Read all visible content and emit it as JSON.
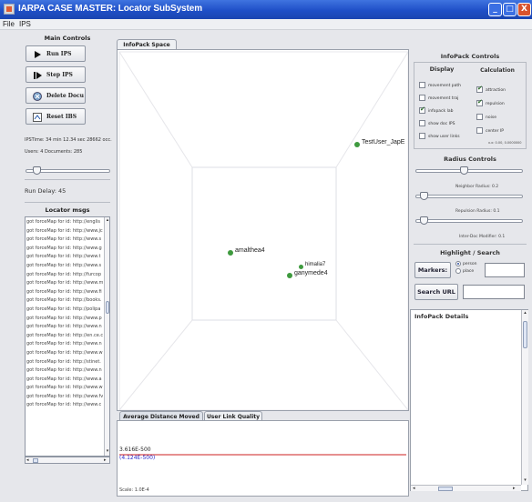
{
  "window": {
    "title": "IARPA CASE MASTER: Locator SubSystem",
    "min": "_",
    "max": "□",
    "close": "X"
  },
  "menu": {
    "file": "File",
    "ips": "IPS"
  },
  "main_controls": {
    "title": "Main Controls",
    "run": "Run IPS",
    "step": "Step IPS",
    "delete": "Delete Docu",
    "reset": "Reset IBS",
    "ips_time": "IPSTime: 34 min 12.34 sec  28662 occ.",
    "users_docs": "Users: 4  Documents: 285",
    "run_delay": "Run Delay: 45",
    "run_delay_value": 0.1
  },
  "locator_msgs": {
    "title": "Locator msgs",
    "rows": [
      "got forceMap for id: http://englis",
      "got forceMap for id: http://www.jc",
      "got forceMap for id: http://www.s",
      "got forceMap for id: http://www.g",
      "got forceMap for id: http://www.t",
      "got forceMap for id: http://www.s",
      "got forceMap for id: http://furcop",
      "got forceMap for id: http://www.m",
      "got forceMap for id: http://www.fi",
      "got forceMap for id: http://books.",
      "got forceMap for id: http://polipa",
      "got forceMap for id: http://www.p",
      "got forceMap for id: http://www.n",
      "got forceMap for id: http://en.ce.c",
      "got forceMap for id: http://www.n",
      "got forceMap for id: http://www.w",
      "got forceMap for id: http://stinet.",
      "got forceMap for id: http://www.n",
      "got forceMap for id: http://www.a",
      "got forceMap for id: http://www.w",
      "got forceMap for id: http://www.fv",
      "got forceMap for id: http://www.c"
    ],
    "scroll_left": "◂",
    "scroll_right": "▸",
    "scroll_up": "▴",
    "scroll_down": "▾"
  },
  "tabs": {
    "infopack_space": "InfoPack Space"
  },
  "graph_nodes": [
    {
      "label": "TestUser_JapE",
      "color": "#3e9a3e"
    },
    {
      "label": "amalthea4",
      "color": "#3e9a3e"
    },
    {
      "label": "himalia7",
      "color": "#3e9a3e"
    },
    {
      "label": "ganymede4",
      "color": "#3e9a3e"
    }
  ],
  "bottom_tabs": {
    "avg_distance": "Average Distance Moved",
    "user_link": "User Link Quality"
  },
  "chart_data": {
    "type": "line",
    "series": [
      {
        "name": "",
        "color": "#1a1acc",
        "values": [
          0.0,
          0.0,
          0.0,
          0.0,
          0.0,
          0.0,
          0.0
        ]
      },
      {
        "name": "",
        "color": "#cc2222",
        "values": [
          0.0,
          0.0,
          0.0,
          0.0,
          0.0,
          0.0,
          0.0
        ]
      }
    ],
    "readout_top": "3.616E-500",
    "readout_bottom": "(4.124E-500)",
    "scale": "Scale: 1.0E-4"
  },
  "infopack_controls": {
    "title": "InfoPack Controls",
    "display_title": "Display",
    "calc_title": "Calculation",
    "display": [
      {
        "label": "movement path",
        "checked": false
      },
      {
        "label": "movement traj",
        "checked": false
      },
      {
        "label": "infopack lab",
        "checked": true
      },
      {
        "label": "show doc IPS",
        "checked": false
      },
      {
        "label": "show user links",
        "checked": false
      }
    ],
    "calc": [
      {
        "label": "attraction",
        "checked": true
      },
      {
        "label": "repulsion",
        "checked": true
      },
      {
        "label": "noise",
        "checked": false
      },
      {
        "label": "center IP",
        "checked": false
      }
    ],
    "center_note": "x.x: 0.00, 0.0000000"
  },
  "radius_controls": {
    "title": "Radius Controls",
    "neighbor": "Neighbor Radius: 0.2",
    "repulsion": "Repulsion Radius: 0.1",
    "interdoc": "Inter-Doc Modifier: 0.1",
    "top_value": 0.45,
    "neighbor_value": 0.05,
    "repulsion_value": 0.05
  },
  "highlight": {
    "title": "Highlight / Search",
    "markers": "Markers:",
    "person": "person",
    "place": "place",
    "search_url": "Search URL"
  },
  "details": {
    "title": "InfoPack Details",
    "up": "▴",
    "down": "▾",
    "left": "◂",
    "right": "▸"
  }
}
